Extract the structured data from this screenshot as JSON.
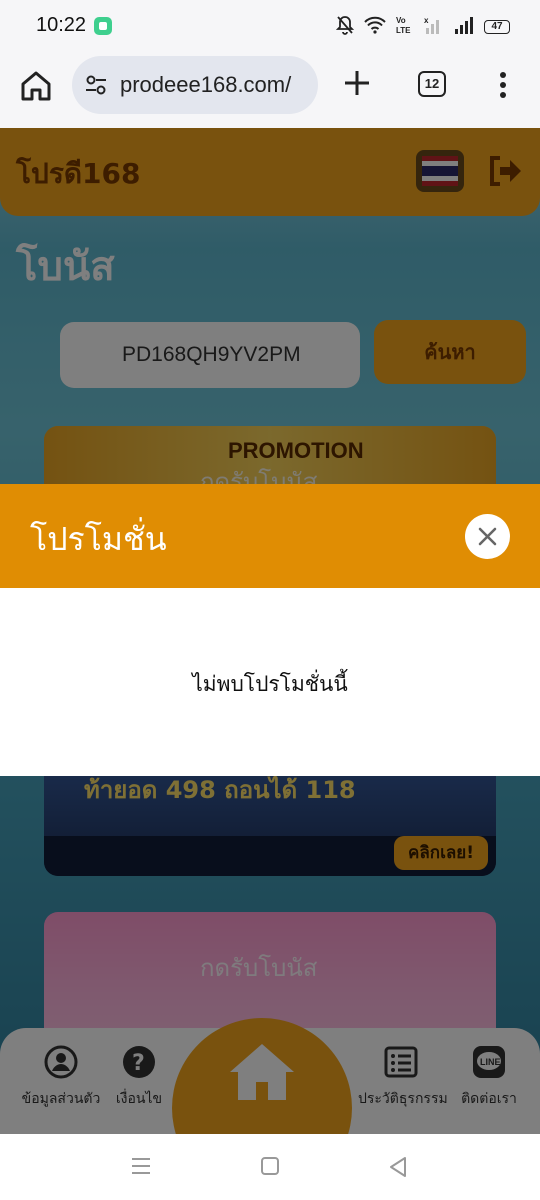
{
  "status_bar": {
    "time": "10:22",
    "battery": "47",
    "icons": [
      "notifications-muted-icon",
      "wifi-icon",
      "volte-icon",
      "signal-x-icon",
      "signal-icon",
      "battery-icon"
    ]
  },
  "browser": {
    "url": "prodeee168.com/",
    "tab_count": "12",
    "icons": [
      "home-icon",
      "site-settings-icon",
      "new-tab-plus-icon",
      "tab-switcher",
      "overflow-menu-icon"
    ]
  },
  "site": {
    "logo": "โปรดี168",
    "page_heading": "โบนัส",
    "code_input_value": "PD168QH9YV2PM",
    "search_button": "ค้นหา",
    "promo1": {
      "ribbon_title": "PROMOTION",
      "overlay_label": "กดรับโบนัส",
      "headline": "ท้ายอด 498 ถอนได้ 118",
      "cta": "คลิกเลย!"
    },
    "promo2": {
      "overlay_label": "กดรับโบนัส"
    },
    "bottom_nav": [
      {
        "label": "ข้อมูลส่วนตัว",
        "icon": "profile-icon"
      },
      {
        "label": "เงื่อนไข",
        "icon": "help-icon"
      },
      {
        "label": "",
        "icon": "home-icon"
      },
      {
        "label": "ประวัติธุรกรรม",
        "icon": "history-list-icon"
      },
      {
        "label": "ติดต่อเรา",
        "icon": "line-chat-icon"
      }
    ]
  },
  "modal": {
    "title": "โปรโมชั่น",
    "message": "ไม่พบโปรโมชั่นนี้",
    "close_icon": "close-icon"
  },
  "colors": {
    "modal_header": "#e08d03",
    "site_accent": "#f3a51c",
    "overlay": "rgba(0,0,0,0.5)"
  }
}
